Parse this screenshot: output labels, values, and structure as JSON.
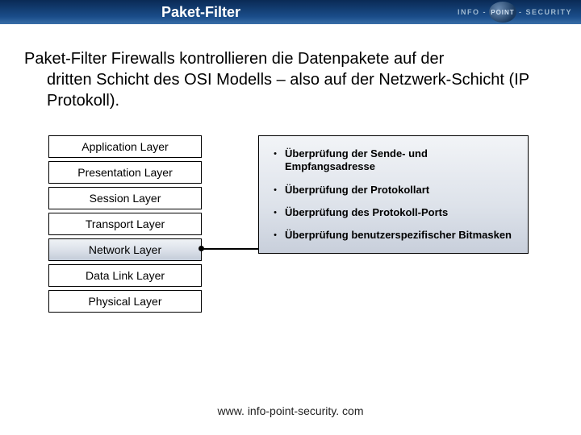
{
  "header": {
    "title": "Paket-Filter",
    "logo": {
      "left": "INFO -",
      "mid": "POINT",
      "right": "- SECURITY"
    }
  },
  "intro": {
    "line1": "Paket-Filter Firewalls kontrollieren die Datenpakete auf der",
    "rest": "dritten Schicht des OSI Modells – also auf der Netzwerk-Schicht (IP Protokoll)."
  },
  "osi": {
    "layers": [
      {
        "label": "Application Layer",
        "hl": false
      },
      {
        "label": "Presentation Layer",
        "hl": false
      },
      {
        "label": "Session Layer",
        "hl": false
      },
      {
        "label": "Transport Layer",
        "hl": false
      },
      {
        "label": "Network Layer",
        "hl": true
      },
      {
        "label": "Data Link Layer",
        "hl": false
      },
      {
        "label": "Physical Layer",
        "hl": false
      }
    ]
  },
  "checks": {
    "items": [
      {
        "text": "Überprüfung der Sende- und Empfangsadresse"
      },
      {
        "text": "Überprüfung der Protokollart"
      },
      {
        "text": "Überprüfung des Protokoll-Ports"
      },
      {
        "text": "Überprüfung benutzerspezifischer Bitmasken"
      }
    ]
  },
  "footer": {
    "url": "www. info-point-security. com"
  }
}
